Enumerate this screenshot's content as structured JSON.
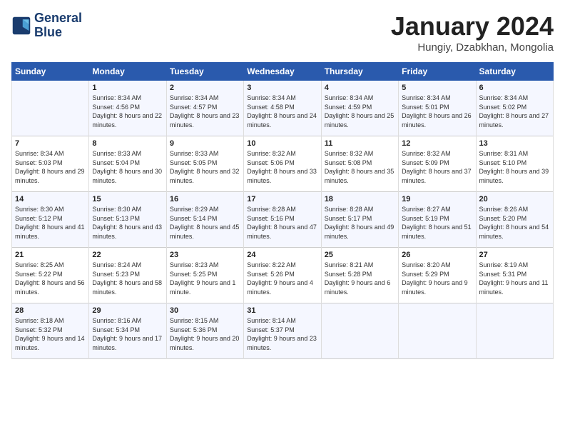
{
  "header": {
    "logo_line1": "General",
    "logo_line2": "Blue",
    "month_title": "January 2024",
    "location": "Hungiy, Dzabkhan, Mongolia"
  },
  "days_of_week": [
    "Sunday",
    "Monday",
    "Tuesday",
    "Wednesday",
    "Thursday",
    "Friday",
    "Saturday"
  ],
  "weeks": [
    [
      {
        "day": "",
        "sunrise": "",
        "sunset": "",
        "daylight": ""
      },
      {
        "day": "1",
        "sunrise": "Sunrise: 8:34 AM",
        "sunset": "Sunset: 4:56 PM",
        "daylight": "Daylight: 8 hours and 22 minutes."
      },
      {
        "day": "2",
        "sunrise": "Sunrise: 8:34 AM",
        "sunset": "Sunset: 4:57 PM",
        "daylight": "Daylight: 8 hours and 23 minutes."
      },
      {
        "day": "3",
        "sunrise": "Sunrise: 8:34 AM",
        "sunset": "Sunset: 4:58 PM",
        "daylight": "Daylight: 8 hours and 24 minutes."
      },
      {
        "day": "4",
        "sunrise": "Sunrise: 8:34 AM",
        "sunset": "Sunset: 4:59 PM",
        "daylight": "Daylight: 8 hours and 25 minutes."
      },
      {
        "day": "5",
        "sunrise": "Sunrise: 8:34 AM",
        "sunset": "Sunset: 5:01 PM",
        "daylight": "Daylight: 8 hours and 26 minutes."
      },
      {
        "day": "6",
        "sunrise": "Sunrise: 8:34 AM",
        "sunset": "Sunset: 5:02 PM",
        "daylight": "Daylight: 8 hours and 27 minutes."
      }
    ],
    [
      {
        "day": "7",
        "sunrise": "Sunrise: 8:34 AM",
        "sunset": "Sunset: 5:03 PM",
        "daylight": "Daylight: 8 hours and 29 minutes."
      },
      {
        "day": "8",
        "sunrise": "Sunrise: 8:33 AM",
        "sunset": "Sunset: 5:04 PM",
        "daylight": "Daylight: 8 hours and 30 minutes."
      },
      {
        "day": "9",
        "sunrise": "Sunrise: 8:33 AM",
        "sunset": "Sunset: 5:05 PM",
        "daylight": "Daylight: 8 hours and 32 minutes."
      },
      {
        "day": "10",
        "sunrise": "Sunrise: 8:32 AM",
        "sunset": "Sunset: 5:06 PM",
        "daylight": "Daylight: 8 hours and 33 minutes."
      },
      {
        "day": "11",
        "sunrise": "Sunrise: 8:32 AM",
        "sunset": "Sunset: 5:08 PM",
        "daylight": "Daylight: 8 hours and 35 minutes."
      },
      {
        "day": "12",
        "sunrise": "Sunrise: 8:32 AM",
        "sunset": "Sunset: 5:09 PM",
        "daylight": "Daylight: 8 hours and 37 minutes."
      },
      {
        "day": "13",
        "sunrise": "Sunrise: 8:31 AM",
        "sunset": "Sunset: 5:10 PM",
        "daylight": "Daylight: 8 hours and 39 minutes."
      }
    ],
    [
      {
        "day": "14",
        "sunrise": "Sunrise: 8:30 AM",
        "sunset": "Sunset: 5:12 PM",
        "daylight": "Daylight: 8 hours and 41 minutes."
      },
      {
        "day": "15",
        "sunrise": "Sunrise: 8:30 AM",
        "sunset": "Sunset: 5:13 PM",
        "daylight": "Daylight: 8 hours and 43 minutes."
      },
      {
        "day": "16",
        "sunrise": "Sunrise: 8:29 AM",
        "sunset": "Sunset: 5:14 PM",
        "daylight": "Daylight: 8 hours and 45 minutes."
      },
      {
        "day": "17",
        "sunrise": "Sunrise: 8:28 AM",
        "sunset": "Sunset: 5:16 PM",
        "daylight": "Daylight: 8 hours and 47 minutes."
      },
      {
        "day": "18",
        "sunrise": "Sunrise: 8:28 AM",
        "sunset": "Sunset: 5:17 PM",
        "daylight": "Daylight: 8 hours and 49 minutes."
      },
      {
        "day": "19",
        "sunrise": "Sunrise: 8:27 AM",
        "sunset": "Sunset: 5:19 PM",
        "daylight": "Daylight: 8 hours and 51 minutes."
      },
      {
        "day": "20",
        "sunrise": "Sunrise: 8:26 AM",
        "sunset": "Sunset: 5:20 PM",
        "daylight": "Daylight: 8 hours and 54 minutes."
      }
    ],
    [
      {
        "day": "21",
        "sunrise": "Sunrise: 8:25 AM",
        "sunset": "Sunset: 5:22 PM",
        "daylight": "Daylight: 8 hours and 56 minutes."
      },
      {
        "day": "22",
        "sunrise": "Sunrise: 8:24 AM",
        "sunset": "Sunset: 5:23 PM",
        "daylight": "Daylight: 8 hours and 58 minutes."
      },
      {
        "day": "23",
        "sunrise": "Sunrise: 8:23 AM",
        "sunset": "Sunset: 5:25 PM",
        "daylight": "Daylight: 9 hours and 1 minute."
      },
      {
        "day": "24",
        "sunrise": "Sunrise: 8:22 AM",
        "sunset": "Sunset: 5:26 PM",
        "daylight": "Daylight: 9 hours and 4 minutes."
      },
      {
        "day": "25",
        "sunrise": "Sunrise: 8:21 AM",
        "sunset": "Sunset: 5:28 PM",
        "daylight": "Daylight: 9 hours and 6 minutes."
      },
      {
        "day": "26",
        "sunrise": "Sunrise: 8:20 AM",
        "sunset": "Sunset: 5:29 PM",
        "daylight": "Daylight: 9 hours and 9 minutes."
      },
      {
        "day": "27",
        "sunrise": "Sunrise: 8:19 AM",
        "sunset": "Sunset: 5:31 PM",
        "daylight": "Daylight: 9 hours and 11 minutes."
      }
    ],
    [
      {
        "day": "28",
        "sunrise": "Sunrise: 8:18 AM",
        "sunset": "Sunset: 5:32 PM",
        "daylight": "Daylight: 9 hours and 14 minutes."
      },
      {
        "day": "29",
        "sunrise": "Sunrise: 8:16 AM",
        "sunset": "Sunset: 5:34 PM",
        "daylight": "Daylight: 9 hours and 17 minutes."
      },
      {
        "day": "30",
        "sunrise": "Sunrise: 8:15 AM",
        "sunset": "Sunset: 5:36 PM",
        "daylight": "Daylight: 9 hours and 20 minutes."
      },
      {
        "day": "31",
        "sunrise": "Sunrise: 8:14 AM",
        "sunset": "Sunset: 5:37 PM",
        "daylight": "Daylight: 9 hours and 23 minutes."
      },
      {
        "day": "",
        "sunrise": "",
        "sunset": "",
        "daylight": ""
      },
      {
        "day": "",
        "sunrise": "",
        "sunset": "",
        "daylight": ""
      },
      {
        "day": "",
        "sunrise": "",
        "sunset": "",
        "daylight": ""
      }
    ]
  ]
}
